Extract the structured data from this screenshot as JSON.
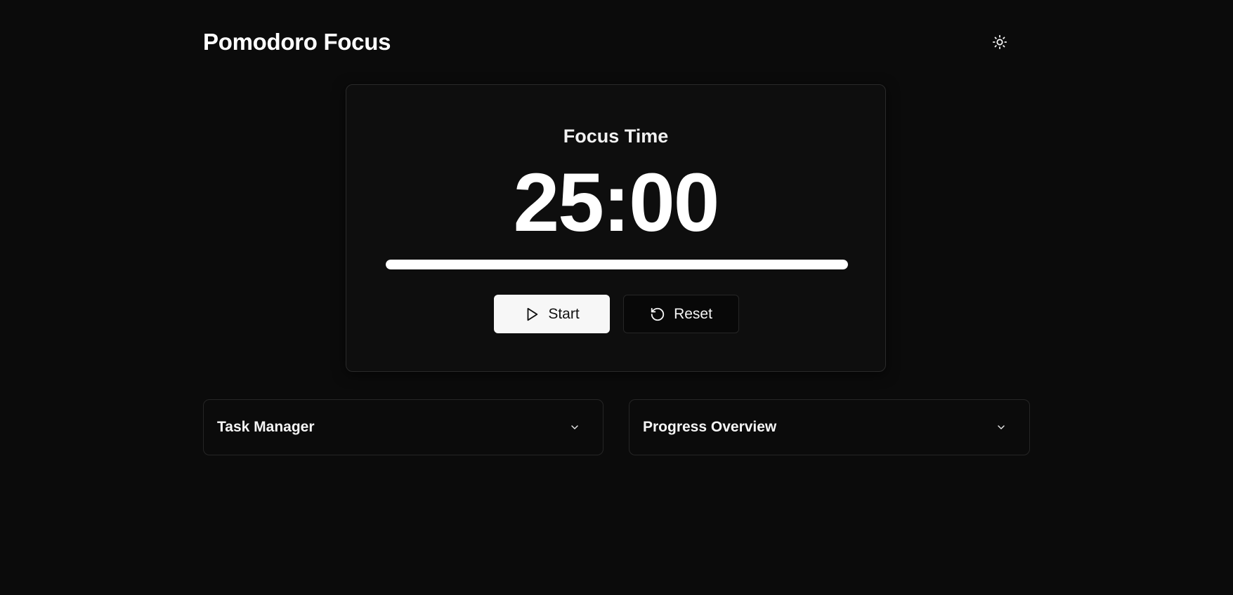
{
  "header": {
    "title": "Pomodoro Focus",
    "theme_toggle_icon": "sun-icon"
  },
  "timer": {
    "mode_label": "Focus Time",
    "time": "25:00",
    "progress_percent": 100,
    "start_label": "Start",
    "start_icon": "play-icon",
    "reset_label": "Reset",
    "reset_icon": "rotate-ccw-icon"
  },
  "panels": [
    {
      "title": "Task Manager",
      "icon": "chevron-down-icon"
    },
    {
      "title": "Progress Overview",
      "icon": "chevron-down-icon"
    }
  ],
  "colors": {
    "background": "#0b0b0b",
    "card": "#0e0e0e",
    "border": "#2a2a2a",
    "accent": "#ffffff"
  }
}
